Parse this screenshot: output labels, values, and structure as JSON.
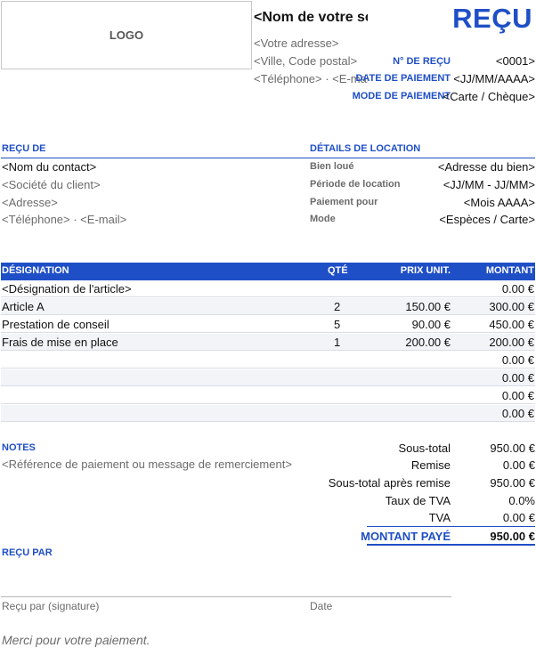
{
  "header": {
    "logo": "LOGO",
    "company_name": "<Nom de votre société>",
    "address": "<Votre adresse>",
    "city": "<Ville, Code postal>",
    "phone_email": "<Téléphone>  ·  <E-mail>",
    "title": "REÇU"
  },
  "receipt_meta": {
    "number_label": "N° DE REÇU",
    "number_value": "<0001>",
    "date_label": "DATE DE PAIEMENT",
    "date_value": "<JJ/MM/AAAA>",
    "mode_label": "MODE DE PAIEMENT",
    "mode_value": "<Carte / Chèque>"
  },
  "received_from": {
    "heading": "REÇU DE",
    "contact": "<Nom du contact>",
    "company": "<Société du client>",
    "address": "<Adresse>",
    "phone_email": "<Téléphone>  ·  <E-mail>"
  },
  "rental": {
    "heading": "DÉTAILS DE LOCATION",
    "rows": [
      {
        "label": "Bien loué",
        "value": "<Adresse du bien>"
      },
      {
        "label": "Période de location",
        "value": "<JJ/MM - JJ/MM>"
      },
      {
        "label": "Paiement pour",
        "value": "<Mois AAAA>"
      },
      {
        "label": "Mode",
        "value": "<Espèces / Carte>"
      }
    ]
  },
  "table": {
    "headers": {
      "designation": "DÉSIGNATION",
      "qty": "QTÉ",
      "unit": "PRIX UNIT.",
      "amount": "MONTANT"
    },
    "rows": [
      {
        "designation": "<Désignation de l'article>",
        "qty": "",
        "unit": "",
        "amount": "0.00 €"
      },
      {
        "designation": "Article A",
        "qty": "2",
        "unit": "150.00 €",
        "amount": "300.00 €"
      },
      {
        "designation": "Prestation de conseil",
        "qty": "5",
        "unit": "90.00 €",
        "amount": "450.00 €"
      },
      {
        "designation": "Frais de mise en place",
        "qty": "1",
        "unit": "200.00 €",
        "amount": "200.00 €"
      },
      {
        "designation": "",
        "qty": "",
        "unit": "",
        "amount": "0.00 €"
      },
      {
        "designation": "",
        "qty": "",
        "unit": "",
        "amount": "0.00 €"
      },
      {
        "designation": "",
        "qty": "",
        "unit": "",
        "amount": "0.00 €"
      },
      {
        "designation": "",
        "qty": "",
        "unit": "",
        "amount": "0.00 €"
      }
    ]
  },
  "notes": {
    "heading": "NOTES",
    "text": "<Référence de paiement ou message de remerciement>"
  },
  "summary": {
    "subtotal_label": "Sous-total",
    "subtotal": "950.00 €",
    "discount_label": "Remise",
    "discount": "0.00 €",
    "after_discount_label": "Sous-total après remise",
    "after_discount": "950.00 €",
    "tax_rate_label": "Taux de TVA",
    "tax_rate": "0.0%",
    "tax_label": "TVA",
    "tax": "0.00 €",
    "total_label": "MONTANT PAYÉ",
    "total": "950.00 €"
  },
  "signature": {
    "heading": "REÇU PAR",
    "sign_label": "Reçu par (signature)",
    "date_label": "Date"
  },
  "footer": {
    "thanks": "Merci pour votre paiement."
  }
}
